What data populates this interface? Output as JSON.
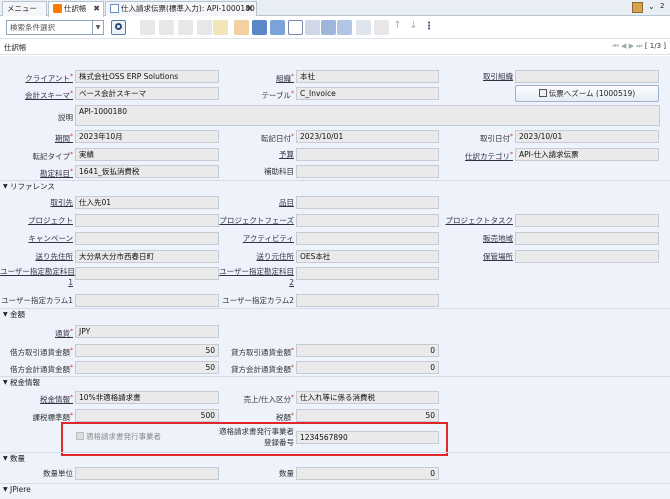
{
  "tabs": [
    {
      "label": "メニュー"
    },
    {
      "label": "仕訳帳",
      "icon": "journal-icon"
    },
    {
      "label": "仕入請求伝票(標準入力): API-1000180",
      "icon": "doc-icon"
    }
  ],
  "toolbar": {
    "search_value": "検索条件選択"
  },
  "window_title": "仕訳帳",
  "record_nav": "[ 1/3 ]",
  "header": {
    "client_label": "クライアント",
    "client_value": "株式会社OSS ERP Solutions",
    "org_label": "組織",
    "org_value": "本社",
    "trx_org_label": "取引組織",
    "trx_org_value": "",
    "schema_label": "会計スキーマ",
    "schema_value": "ベース会計スキーマ",
    "table_label": "テーブル",
    "table_value": "C_Invoice",
    "zoom_button": "伝票へズーム (1000519)",
    "desc_label": "説明",
    "desc_value": "API-1000180",
    "period_label": "期間",
    "period_value": "2023年10月",
    "dateacct_label": "転記日付",
    "dateacct_value": "2023/10/01",
    "datetrx_label": "取引日付",
    "datetrx_value": "2023/10/01",
    "postingtype_label": "転記タイプ",
    "postingtype_value": "実績",
    "budget_label": "予算",
    "budget_value": "",
    "glcategory_label": "仕訳カテゴリ",
    "glcategory_value": "API-仕入請求伝票",
    "account_label": "勘定科目",
    "account_value": "1641_仮払消費税",
    "subacct_label": "補助科目",
    "subacct_value": ""
  },
  "sections": {
    "reference": "リファレンス",
    "amount": "金額",
    "tax": "税金情報",
    "qty": "数量",
    "jpiere": "JPiere"
  },
  "reference": {
    "bpartner_label": "取引先",
    "bpartner_value": "仕入先01",
    "product_label": "品目",
    "product_value": "",
    "project_label": "プロジェクト",
    "project_value": "",
    "phase_label": "プロジェクトフェーズ",
    "phase_value": "",
    "task_label": "プロジェクトタスク",
    "task_value": "",
    "campaign_label": "キャンペーン",
    "campaign_value": "",
    "activity_label": "アクティビティ",
    "activity_value": "",
    "region_label": "販売地域",
    "region_value": "",
    "locto_label": "送り先住所",
    "locto_value": "大分県大分市西春日町",
    "locfrom_label": "送り元住所",
    "locfrom_value": "OES本社",
    "warehouse_label": "保管場所",
    "warehouse_value": "",
    "user1_label_a": "ユーザー指定勘定科目",
    "user1_label_b": "1",
    "user1_value": "",
    "user2_label_a": "ユーザー指定勘定科目",
    "user2_label_b": "2",
    "user2_value": "",
    "col1_label": "ユーザー指定カラム1",
    "col1_value": "",
    "col2_label": "ユーザー指定カラム2",
    "col2_value": ""
  },
  "amount": {
    "currency_label": "通貨",
    "currency_value": "JPY",
    "amtsrcdr_label": "借方取引通貨金額",
    "amtsrcdr_value": "50",
    "amtsrccr_label": "貸方取引通貨金額",
    "amtsrccr_value": "0",
    "amtacctdr_label": "借方会計通貨金額",
    "amtacctdr_value": "50",
    "amtacctcr_label": "貸方会計通貨金額",
    "amtacctcr_value": "0"
  },
  "tax": {
    "taxinfo_label": "税金情報",
    "taxinfo_value": "10%非適格請求書",
    "sopo_label": "売上/仕入区分",
    "sopo_value": "仕入れ等に係る消費税",
    "taxbase_label": "課税標準額",
    "taxbase_value": "500",
    "taxamt_label": "税額",
    "taxamt_value": "50",
    "qualified_check_label": "適格請求書発行事業者",
    "regno_label_a": "適格請求書発行事業者",
    "regno_label_b": "登録番号",
    "regno_value": "1234567890"
  },
  "qty": {
    "uom_label": "数量単位",
    "uom_value": "",
    "qty_label": "数量",
    "qty_value": "0"
  },
  "colors": {
    "accent": "#ff7a00",
    "highlight": "#e0262a",
    "panel": "#edf2fb"
  }
}
